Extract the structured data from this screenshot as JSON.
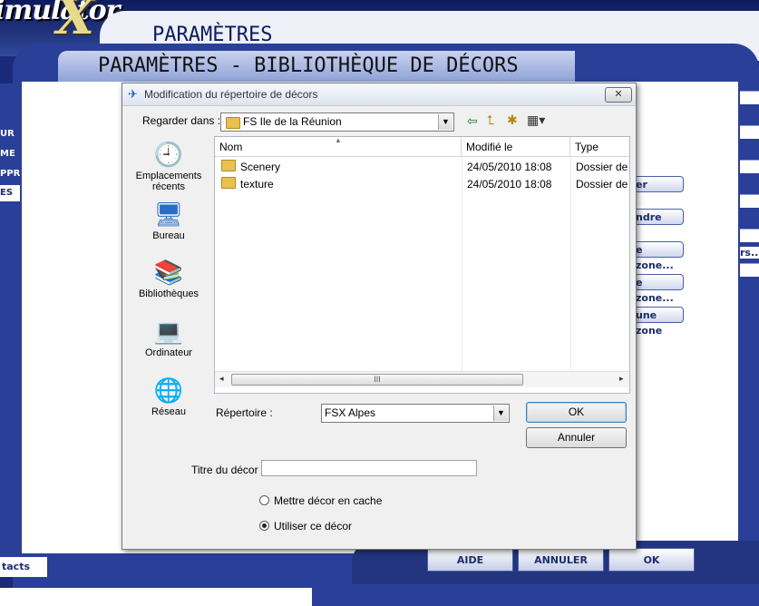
{
  "app": {
    "logo_text": "imulator",
    "logo_x": "X",
    "outer_title": "PARAMÈTRES",
    "inner_title": "PARAMÈTRES - BIBLIOTHÈQUE DE DÉCORS",
    "left_nav": [
      "UR",
      "ME",
      "PPR",
      "ES"
    ],
    "side_buttons": [
      "er",
      "ndre",
      "e zone...",
      "e zone...",
      "une zone"
    ],
    "right_edge_text": "rs...",
    "bottom_buttons": {
      "help": "AIDE",
      "cancel": "ANNULER",
      "ok": "OK"
    },
    "contacts": "tacts"
  },
  "dialog": {
    "title": "Modification du répertoire de décors",
    "close": "✕",
    "look_in_label": "Regarder dans :",
    "look_in_value": "FS Ile de la Réunion",
    "places": [
      {
        "icon": "recent-places-icon",
        "glyph": "🕘",
        "label_line1": "Emplacements",
        "label_line2": "récents"
      },
      {
        "icon": "desktop-icon",
        "glyph": "🖥",
        "label_line1": "Bureau",
        "label_line2": ""
      },
      {
        "icon": "libraries-icon",
        "glyph": "📚",
        "label_line1": "Bibliothèques",
        "label_line2": ""
      },
      {
        "icon": "computer-icon",
        "glyph": "💻",
        "label_line1": "Ordinateur",
        "label_line2": ""
      },
      {
        "icon": "network-icon",
        "glyph": "🌐",
        "label_line1": "Réseau",
        "label_line2": ""
      }
    ],
    "columns": {
      "name": "Nom",
      "modified": "Modifié le",
      "type": "Type"
    },
    "files": [
      {
        "name": "Scenery",
        "modified": "24/05/2010 18:08",
        "type": "Dossier de f"
      },
      {
        "name": "texture",
        "modified": "24/05/2010 18:08",
        "type": "Dossier de f"
      }
    ],
    "scroll_grip": "III",
    "directory_label": "Répertoire :",
    "directory_value": "FSX Alpes",
    "ok": "OK",
    "cancel": "Annuler",
    "scenery_title_label": "Titre du décor :",
    "scenery_title_value": "",
    "radio_cache": "Mettre décor en cache",
    "radio_use": "Utiliser ce décor",
    "selected_radio": "use"
  }
}
